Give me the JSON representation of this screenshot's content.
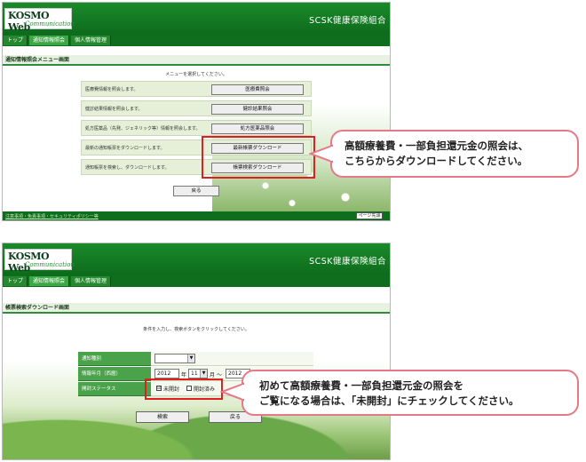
{
  "screen1": {
    "logo_main": "KOSMO Web",
    "logo_sub": "Communication",
    "org_name": "SCSK健康保険組合",
    "tabs": [
      {
        "label": "トップ"
      },
      {
        "label": "通知情報照会"
      },
      {
        "label": "個人情報管理"
      }
    ],
    "page_title": "通知情報照会メニュー画面",
    "instruction": "メニューを選択してください。",
    "menu": [
      {
        "desc": "医療費情報を照会します。",
        "button": "医療費照会"
      },
      {
        "desc": "健診結果情報を照会します。",
        "button": "健診結果照会"
      },
      {
        "desc": "処方医薬品（先発、ジェネリック等）情報を照会します。",
        "button": "処方医薬品照会"
      },
      {
        "desc": "最新の通知帳票をダウンロードします。",
        "button": "最新帳票ダウンロード"
      },
      {
        "desc": "通知帳票を検索し、ダウンロードします。",
        "button": "帳票検索ダウンロード"
      }
    ],
    "back_button": "戻る",
    "footer_link": "注意事項・免責事項・セキュリティポリシー等",
    "footer_badge": "ページ先頭",
    "callout_text": [
      "高額療養費・一部負担還元金の照会は、",
      "こちらからダウンロードしてください。"
    ]
  },
  "screen2": {
    "logo_main": "KOSMO Web",
    "logo_sub": "Communication",
    "org_name": "SCSK健康保険組合",
    "tabs": [
      {
        "label": "トップ"
      },
      {
        "label": "通知情報照会"
      },
      {
        "label": "個人情報管理"
      }
    ],
    "page_title": "帳票検索ダウンロード画面",
    "instruction": "条件を入力し、検索ボタンをクリックしてください。",
    "fields": {
      "notice_type_label": "通知種別",
      "notice_type_value": "",
      "date_label": "情報年月（西暦）",
      "from_year": "2012",
      "year_unit": "年",
      "from_month": "11",
      "month_unit": "月",
      "range_sep": "～",
      "to_year": "2012",
      "to_year_unit": "年",
      "status_label": "開封ステータス",
      "unopened_label": "未開封",
      "unopened_checked": "☑",
      "opened_label": "開封済み",
      "opened_checked": ""
    },
    "search_button": "検索",
    "back_button": "戻る",
    "callout_text": [
      "初めて高額療養費・一部負担還元金の照会を",
      "ご覧になる場合は、「未開封」にチェックしてください。"
    ]
  }
}
